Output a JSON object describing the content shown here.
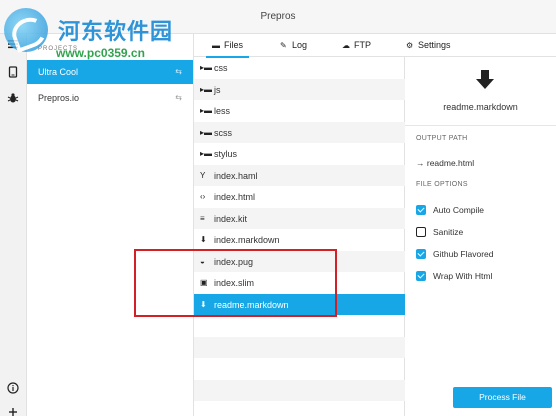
{
  "window": {
    "title": "Prepros"
  },
  "watermark": {
    "title": "河东软件园",
    "url": "www.pc0359.cn"
  },
  "iconbar": {
    "top_icons": [
      "menu-icon",
      "mobile-preview-icon",
      "bug-icon"
    ],
    "bottom_icons": [
      "info-icon",
      "add-icon"
    ]
  },
  "projects": {
    "header": "PROJECTS",
    "items": [
      {
        "label": "Ultra Cool",
        "active": true
      },
      {
        "label": "Prepros.io",
        "active": false
      }
    ]
  },
  "tabs": [
    {
      "label": "Files",
      "icon": "folder-icon",
      "active": true
    },
    {
      "label": "Log",
      "icon": "pencil-icon",
      "active": false
    },
    {
      "label": "FTP",
      "icon": "cloud-upload-icon",
      "active": false
    },
    {
      "label": "Settings",
      "icon": "gear-icon",
      "active": false
    }
  ],
  "files": [
    {
      "label": "css",
      "icon": "folder-icon",
      "type": "folder"
    },
    {
      "label": "js",
      "icon": "folder-icon",
      "type": "folder"
    },
    {
      "label": "less",
      "icon": "folder-icon",
      "type": "folder"
    },
    {
      "label": "scss",
      "icon": "folder-icon",
      "type": "folder"
    },
    {
      "label": "stylus",
      "icon": "folder-icon",
      "type": "folder"
    },
    {
      "label": "index.haml",
      "icon": "haml-icon",
      "type": "file"
    },
    {
      "label": "index.html",
      "icon": "code-icon",
      "type": "file"
    },
    {
      "label": "index.kit",
      "icon": "lines-icon",
      "type": "file"
    },
    {
      "label": "index.markdown",
      "icon": "markdown-icon",
      "type": "file"
    },
    {
      "label": "index.pug",
      "icon": "pug-icon",
      "type": "file"
    },
    {
      "label": "index.slim",
      "icon": "slim-icon",
      "type": "file"
    },
    {
      "label": "readme.markdown",
      "icon": "markdown-icon",
      "type": "file",
      "selected": true
    }
  ],
  "detail": {
    "icon": "markdown-download-icon",
    "file_name": "readme.markdown",
    "output_path_header": "OUTPUT PATH",
    "output_path": "→ readme.html",
    "file_options_header": "FILE OPTIONS",
    "options": [
      {
        "label": "Auto Compile",
        "checked": true
      },
      {
        "label": "Sanitize",
        "checked": false
      },
      {
        "label": "Github Flavored",
        "checked": true
      },
      {
        "label": "Wrap With Html",
        "checked": true
      }
    ],
    "process_button": "Process File"
  },
  "colors": {
    "accent": "#17a7e6",
    "highlight_box": "#d31f26"
  }
}
